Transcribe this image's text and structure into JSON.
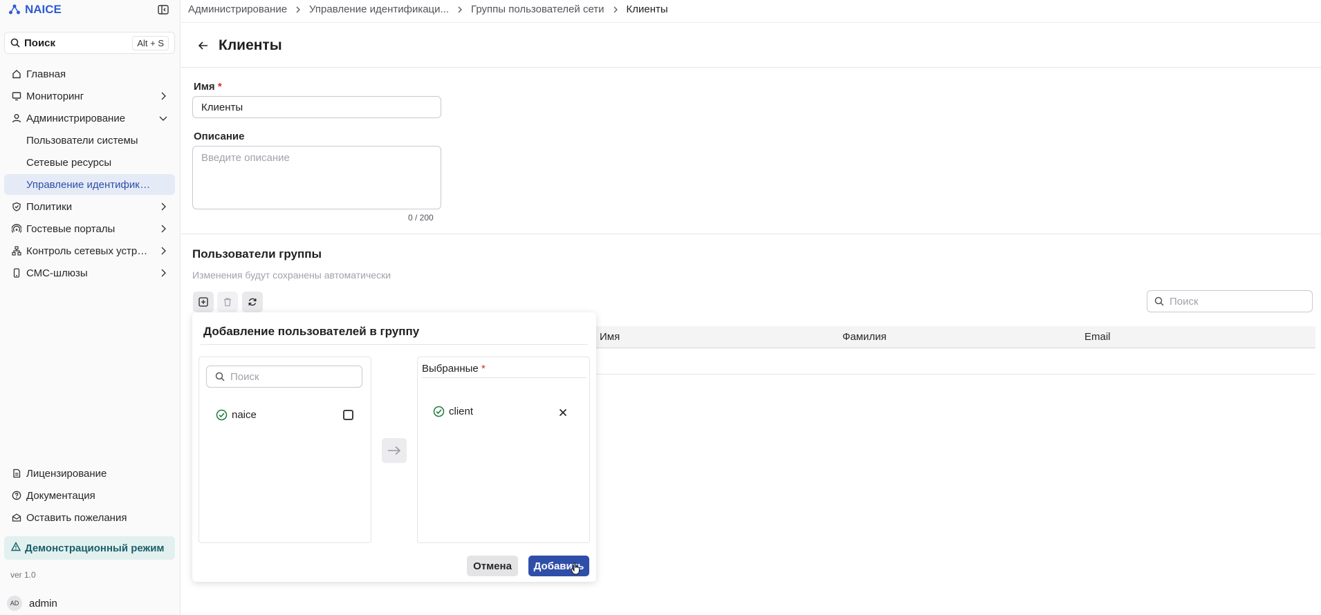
{
  "app": {
    "name": "NAICE",
    "version": "ver 1.0",
    "accent": "#2f4ea8"
  },
  "sidebar": {
    "search": {
      "label": "Поиск",
      "shortcut": "Alt + S"
    },
    "items": [
      {
        "label": "Главная",
        "icon": "home-icon"
      },
      {
        "label": "Мониторинг",
        "icon": "monitor-icon"
      },
      {
        "label": "Администрирование",
        "icon": "user-icon"
      },
      {
        "label": "Пользователи системы"
      },
      {
        "label": "Сетевые ресурсы"
      },
      {
        "label": "Управление идентификацией",
        "active": true
      },
      {
        "label": "Политики",
        "icon": "shield-check-icon"
      },
      {
        "label": "Гостевые порталы",
        "icon": "wifi-icon"
      },
      {
        "label": "Контроль сетевых устро...",
        "icon": "network-icon"
      },
      {
        "label": "СМС-шлюзы",
        "icon": "phone-icon"
      }
    ],
    "bottom": [
      {
        "label": "Лицензирование",
        "icon": "license-icon"
      },
      {
        "label": "Документация",
        "icon": "help-icon"
      },
      {
        "label": "Оставить пожелания",
        "icon": "mail-icon"
      }
    ],
    "demo_mode": "Демонстрационный режим",
    "user": {
      "initials": "AD",
      "name": "admin"
    }
  },
  "breadcrumb": {
    "items": [
      "Администрирование",
      "Управление идентификаци...",
      "Группы пользователей сети"
    ],
    "current": "Клиенты"
  },
  "page": {
    "title": "Клиенты"
  },
  "form": {
    "name_label": "Имя",
    "name_value": "Клиенты",
    "description_label": "Описание",
    "description_placeholder": "Введите описание",
    "description_counter": "0 / 200",
    "required_mark": "*"
  },
  "group_users": {
    "title": "Пользователи группы",
    "subtitle": "Изменения будут сохранены автоматически",
    "search_placeholder": "Поиск",
    "columns": [
      "Имя",
      "Фамилия",
      "Email"
    ]
  },
  "modal": {
    "title": "Добавление пользователей в группу",
    "search_placeholder": "Поиск",
    "available": [
      {
        "name": "naice"
      }
    ],
    "selected_label": "Выбранные",
    "selected": [
      {
        "name": "client"
      }
    ],
    "cancel": "Отмена",
    "add": "Добавить"
  }
}
